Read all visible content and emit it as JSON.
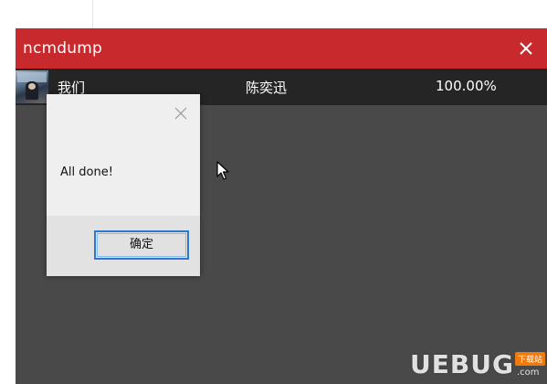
{
  "window": {
    "title": "ncmdump",
    "accent_color": "#c8292d",
    "background_color": "#494949"
  },
  "tracks": [
    {
      "title": "我们",
      "artist": "陈奕迅",
      "progress": "100.00%"
    }
  ],
  "dialog": {
    "message": "All done!",
    "ok_label": "确定"
  },
  "icons": {
    "window_close": "close-icon",
    "dialog_close": "close-icon",
    "cursor": "mouse-pointer-icon"
  },
  "watermark": {
    "brand": "UEBUG",
    "tag": "下载站",
    "domain": ".com"
  }
}
